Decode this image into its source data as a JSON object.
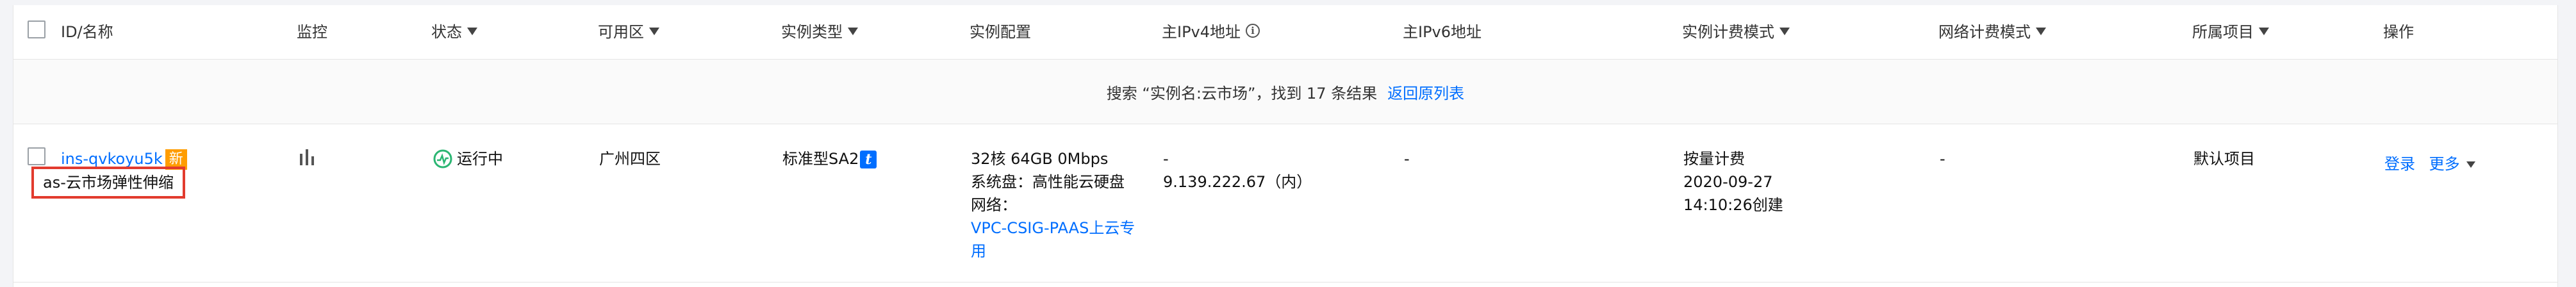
{
  "headers": {
    "id_name": "ID/名称",
    "monitor": "监控",
    "status": "状态",
    "zone": "可用区",
    "instance_type": "实例类型",
    "instance_config": "实例配置",
    "ipv4": "主IPv4地址",
    "ipv6": "主IPv6地址",
    "billing_mode": "实例计费模式",
    "net_billing_mode": "网络计费模式",
    "project": "所属项目",
    "actions": "操作"
  },
  "search_notice": {
    "text": "搜索 “实例名:云市场”，找到 17 条结果",
    "back_link": "返回原列表"
  },
  "row": {
    "instance_id": "ins-qvkoyu5k",
    "new_badge": "新",
    "alias": "as-云市场弹性伸缩",
    "status": "运行中",
    "zone": "广州四区",
    "type": "标准型SA2",
    "type_tag": "t",
    "config_spec": "32核 64GB 0Mbps",
    "config_disk": "系统盘：高性能云硬盘",
    "config_network_label": "网络：",
    "config_network_line1": "VPC-CSIG-PAAS上云专",
    "config_network_line2": "用",
    "ipv4_dash": "-",
    "ipv4": "9.139.222.67（内）",
    "ipv6": "-",
    "billing_mode": "按量计费",
    "billing_date": "2020-09-27",
    "billing_time": "14:10:26创建",
    "net_billing": "-",
    "project": "默认项目",
    "action_login": "登录",
    "action_more": "更多"
  },
  "colors": {
    "link": "#006eff",
    "badge": "#ff9d00",
    "status_icon": "#2bb673",
    "highlight_border": "#e23b2e"
  }
}
